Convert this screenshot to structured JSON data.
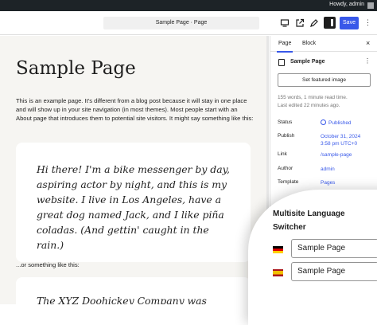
{
  "admin_bar": {
    "greeting": "Howdy, admin"
  },
  "header": {
    "document_title": "Sample Page · Page",
    "save_label": "Save",
    "more_label": "⋮"
  },
  "content": {
    "title": "Sample Page",
    "paragraph": "This is an example page. It's different from a blog post because it will stay in one place and will show up in your site navigation (in most themes). Most people start with an About page that introduces them to potential site visitors. It might say something like this:",
    "quote": "Hi there! I'm a bike messenger by day, aspiring actor by night, and this is my website. I live in Los Angeles, have a great dog named Jack, and I like piña coladas. (And gettin' caught in the rain.)",
    "paragraph2": "...or something like this:",
    "quote2": "The XYZ Doohickey Company was"
  },
  "sidebar": {
    "tabs": [
      {
        "label": "Page"
      },
      {
        "label": "Block"
      }
    ],
    "close_label": "×",
    "doc_name": "Sample Page",
    "doc_more": "⋮",
    "featured_image_button": "Set featured image",
    "meta_words": "155 words, 1 minute read time.",
    "meta_edited": "Last edited 22 minutes ago.",
    "rows": [
      {
        "label": "Status",
        "value": "Published"
      },
      {
        "label": "Publish",
        "value": "October 31, 2024 3:58 pm UTC+0"
      },
      {
        "label": "Link",
        "value": "/sample-page"
      },
      {
        "label": "Author",
        "value": "admin"
      },
      {
        "label": "Template",
        "value": "Pages"
      }
    ]
  },
  "language_switcher": {
    "title": "Multisite Language Switcher",
    "entries": [
      {
        "flag": "de-flag",
        "value": "Sample Page"
      },
      {
        "flag": "es-flag",
        "value": "Sample Page"
      }
    ]
  }
}
